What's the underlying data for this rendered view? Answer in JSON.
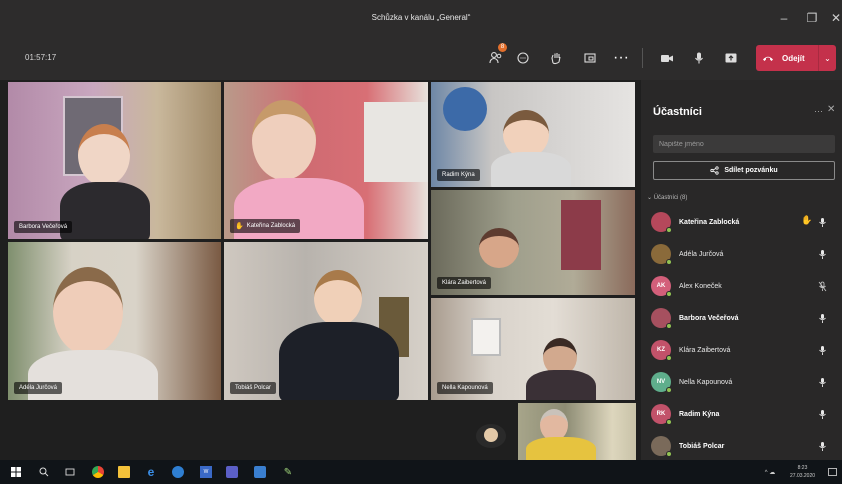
{
  "window": {
    "title": "Schůzka v kanálu „General“",
    "minimize": "–",
    "maximize": "❐",
    "close": "✕"
  },
  "toolbar": {
    "timer": "01:57:17",
    "participants_badge": "8",
    "more": "···",
    "leave_label": "Odejít",
    "leave_caret": "⌄"
  },
  "tiles": [
    {
      "name": "Barbora Večeřová",
      "hand_raised": false
    },
    {
      "name": "Kateřina Zablocká",
      "hand_raised": true
    },
    {
      "name": "Radim Kýna",
      "hand_raised": false
    },
    {
      "name": "Klára Zaibertová",
      "hand_raised": false
    },
    {
      "name": "Adéla Jurčová",
      "hand_raised": false
    },
    {
      "name": "Tobiáš Polcar",
      "hand_raised": false
    },
    {
      "name": "Nella Kapounová",
      "hand_raised": false
    }
  ],
  "panel": {
    "title": "Účastníci",
    "more": "···",
    "close": "✕",
    "search_placeholder": "Napište jméno",
    "invite_label": "Sdílet pozvánku",
    "section_label": "Účastníci (8)",
    "participants": [
      {
        "name": "Kateřina Zablocká",
        "initials": "",
        "avatar_color": "#b5485b",
        "hand_raised": true,
        "muted": false,
        "bold": true
      },
      {
        "name": "Adéla Jurčová",
        "initials": "",
        "avatar_color": "#8a6a3a",
        "hand_raised": false,
        "muted": false,
        "bold": false
      },
      {
        "name": "Alex Koneček",
        "initials": "AK",
        "avatar_color": "#d35f7a",
        "hand_raised": false,
        "muted": true,
        "bold": false
      },
      {
        "name": "Barbora Večeřová",
        "initials": "",
        "avatar_color": "#a6505f",
        "hand_raised": false,
        "muted": false,
        "bold": true
      },
      {
        "name": "Klára Zaibertová",
        "initials": "KZ",
        "avatar_color": "#c2526a",
        "hand_raised": false,
        "muted": false,
        "bold": false
      },
      {
        "name": "Nella Kapounová",
        "initials": "NV",
        "avatar_color": "#5fae8c",
        "hand_raised": false,
        "muted": false,
        "bold": false
      },
      {
        "name": "Radim Kýna",
        "initials": "RK",
        "avatar_color": "#c2526a",
        "hand_raised": false,
        "muted": false,
        "bold": true
      },
      {
        "name": "Tobiáš Polcar",
        "initials": "",
        "avatar_color": "#7a6a5a",
        "hand_raised": false,
        "muted": false,
        "bold": true
      }
    ]
  },
  "taskbar": {
    "time": "8:23",
    "date": "27.03.2020",
    "tray": "^ ☁"
  },
  "colors": {
    "leave": "#c4314b",
    "raised_hand": "#ffc93c",
    "panel_bg": "#292828",
    "titlebar_bg": "#2d2c2c"
  }
}
